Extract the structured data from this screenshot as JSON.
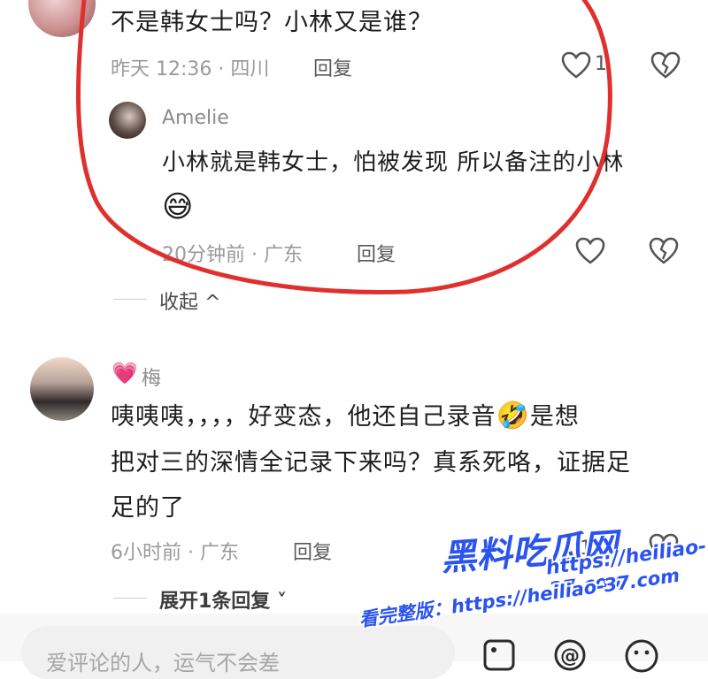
{
  "comment1": {
    "text": "不是韩女士吗？小林又是谁？",
    "time": "昨天 12:36 · 四川",
    "reply_label": "回复",
    "like_count": "1"
  },
  "reply1": {
    "username": "Amelie",
    "text_line1": "小林就是韩女士，怕被发现 所以备注的小林",
    "emoji": "😅",
    "time": "20分钟前 · 广东",
    "reply_label": "回复"
  },
  "collapse_label": "收起 ^",
  "comment2": {
    "username": "梅",
    "name_badge": "💗",
    "text_line1": "咦咦咦，，，，好变态，他还自己录音",
    "laugh_emoji": "🤣",
    "text_line1_suffix": "是想",
    "text_line2": "把对三的深情全记录下来吗？真系死咯，证据足",
    "text_line3": "足的了",
    "time": "6小时前 · 广东",
    "reply_label": "回复",
    "like_count": "15"
  },
  "expand_label": "展开1条回复 ˅",
  "composer": {
    "placeholder": "爱评论的人，运气不会差"
  },
  "watermark": {
    "title": "黑料吃瓜网",
    "url": "https://heiliao-37.com",
    "caption": "看完整版：https://heiliao-37.com"
  },
  "colors": {
    "annotation_red": "#e0302e",
    "watermark_blue": "#2a53f0"
  }
}
